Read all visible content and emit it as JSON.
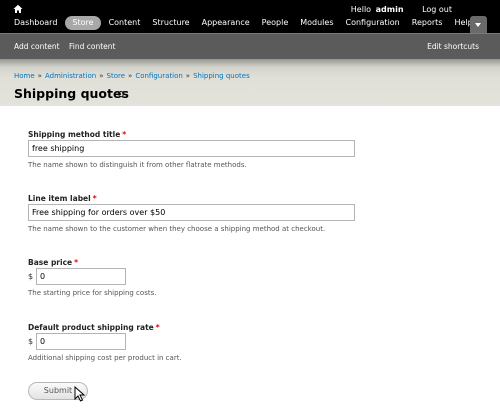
{
  "toolbar": {
    "home_icon": "home-icon",
    "user": {
      "hello": "Hello",
      "name": "admin",
      "logout": "Log out"
    },
    "menu": [
      {
        "label": "Dashboard",
        "active": false
      },
      {
        "label": "Store",
        "active": true
      },
      {
        "label": "Content",
        "active": false
      },
      {
        "label": "Structure",
        "active": false
      },
      {
        "label": "Appearance",
        "active": false
      },
      {
        "label": "People",
        "active": false
      },
      {
        "label": "Modules",
        "active": false
      },
      {
        "label": "Configuration",
        "active": false
      },
      {
        "label": "Reports",
        "active": false
      },
      {
        "label": "Help",
        "active": false
      }
    ]
  },
  "shortcuts": {
    "items": [
      "Add content",
      "Find content"
    ],
    "edit": "Edit shortcuts"
  },
  "breadcrumb": [
    "Home",
    "Administration",
    "Store",
    "Configuration",
    "Shipping quotes"
  ],
  "breadcrumb_sep": "»",
  "page_title": "Shipping quotes",
  "form": {
    "shipping_method_title": {
      "label": "Shipping method title",
      "required": "*",
      "value": "free shipping",
      "description": "The name shown to distinguish it from other flatrate methods."
    },
    "line_item_label": {
      "label": "Line item label",
      "required": "*",
      "value": "Free shipping for orders over $50",
      "description": "The name shown to the customer when they choose a shipping method at checkout."
    },
    "base_price": {
      "label": "Base price",
      "required": "*",
      "prefix": "$",
      "value": "0",
      "description": "The starting price for shipping costs."
    },
    "default_product_rate": {
      "label": "Default product shipping rate",
      "required": "*",
      "prefix": "$",
      "value": "0",
      "description": "Additional shipping cost per product in cart."
    },
    "submit": "Submit"
  },
  "colors": {
    "toolbar_bg": "#000000",
    "shortcuts_bg": "#5b5b5b",
    "link": "#0074bd",
    "required": "#ee0000"
  }
}
